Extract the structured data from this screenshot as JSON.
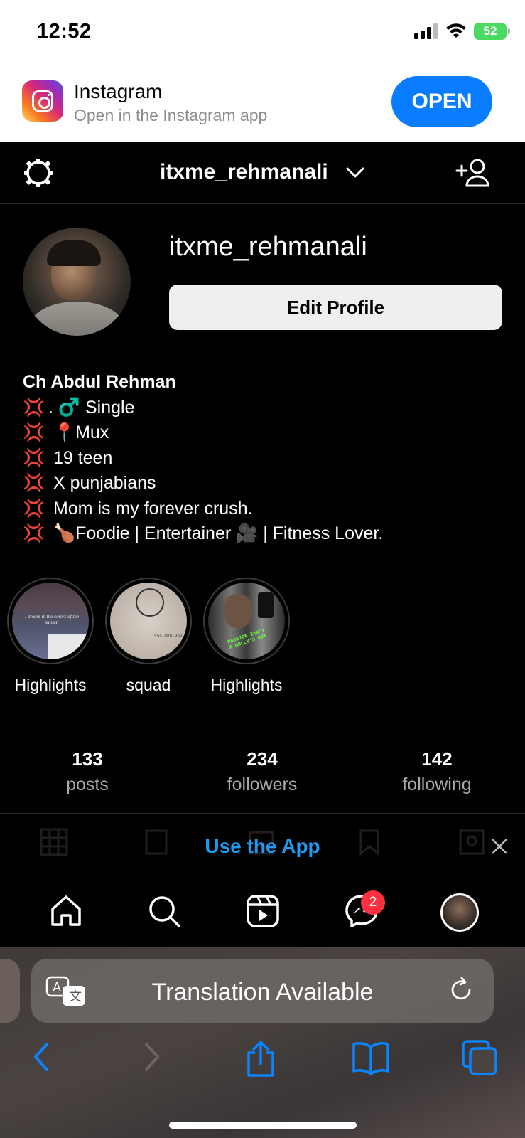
{
  "status_bar": {
    "time": "12:52",
    "battery": "52"
  },
  "app_banner": {
    "name": "Instagram",
    "subtitle": "Open in the Instagram app",
    "open_label": "OPEN"
  },
  "top_nav": {
    "username": "itxme_rehmanali"
  },
  "profile": {
    "username": "itxme_rehmanali",
    "edit_label": "Edit Profile",
    "full_name": "Ch Abdul Rehman",
    "bio_lines": [
      {
        "emoji": "💢",
        "text": ". ♂️  Single"
      },
      {
        "emoji": "💢",
        "text": " 📍Mux"
      },
      {
        "emoji": "💢",
        "text": " 19 teen"
      },
      {
        "emoji": "💢",
        "text": " X punjabians"
      },
      {
        "emoji": "💢",
        "text": " Mom is my forever crush."
      },
      {
        "emoji": "💢",
        "text": " 🍗Foodie | Entertainer 🎥 | Fitness Lover."
      }
    ]
  },
  "highlights": [
    {
      "label": "Highlights",
      "caption": "I dream in the colors of the sunset."
    },
    {
      "label": "squad",
      "caption": "555-888-999"
    },
    {
      "label": "Highlights",
      "caption": "PASSION ISN'T A GOLLY'S HOT"
    }
  ],
  "stats": [
    {
      "value": "133",
      "label": "posts"
    },
    {
      "value": "234",
      "label": "followers"
    },
    {
      "value": "142",
      "label": "following"
    }
  ],
  "use_app": {
    "label": "Use the App"
  },
  "tab_bar": {
    "messages_badge": "2"
  },
  "safari": {
    "translation_label": "Translation Available"
  },
  "colors": {
    "accent": "#0a7cff",
    "link": "#1d9bf0",
    "badge": "#ff3040",
    "battery": "#4cd964"
  }
}
